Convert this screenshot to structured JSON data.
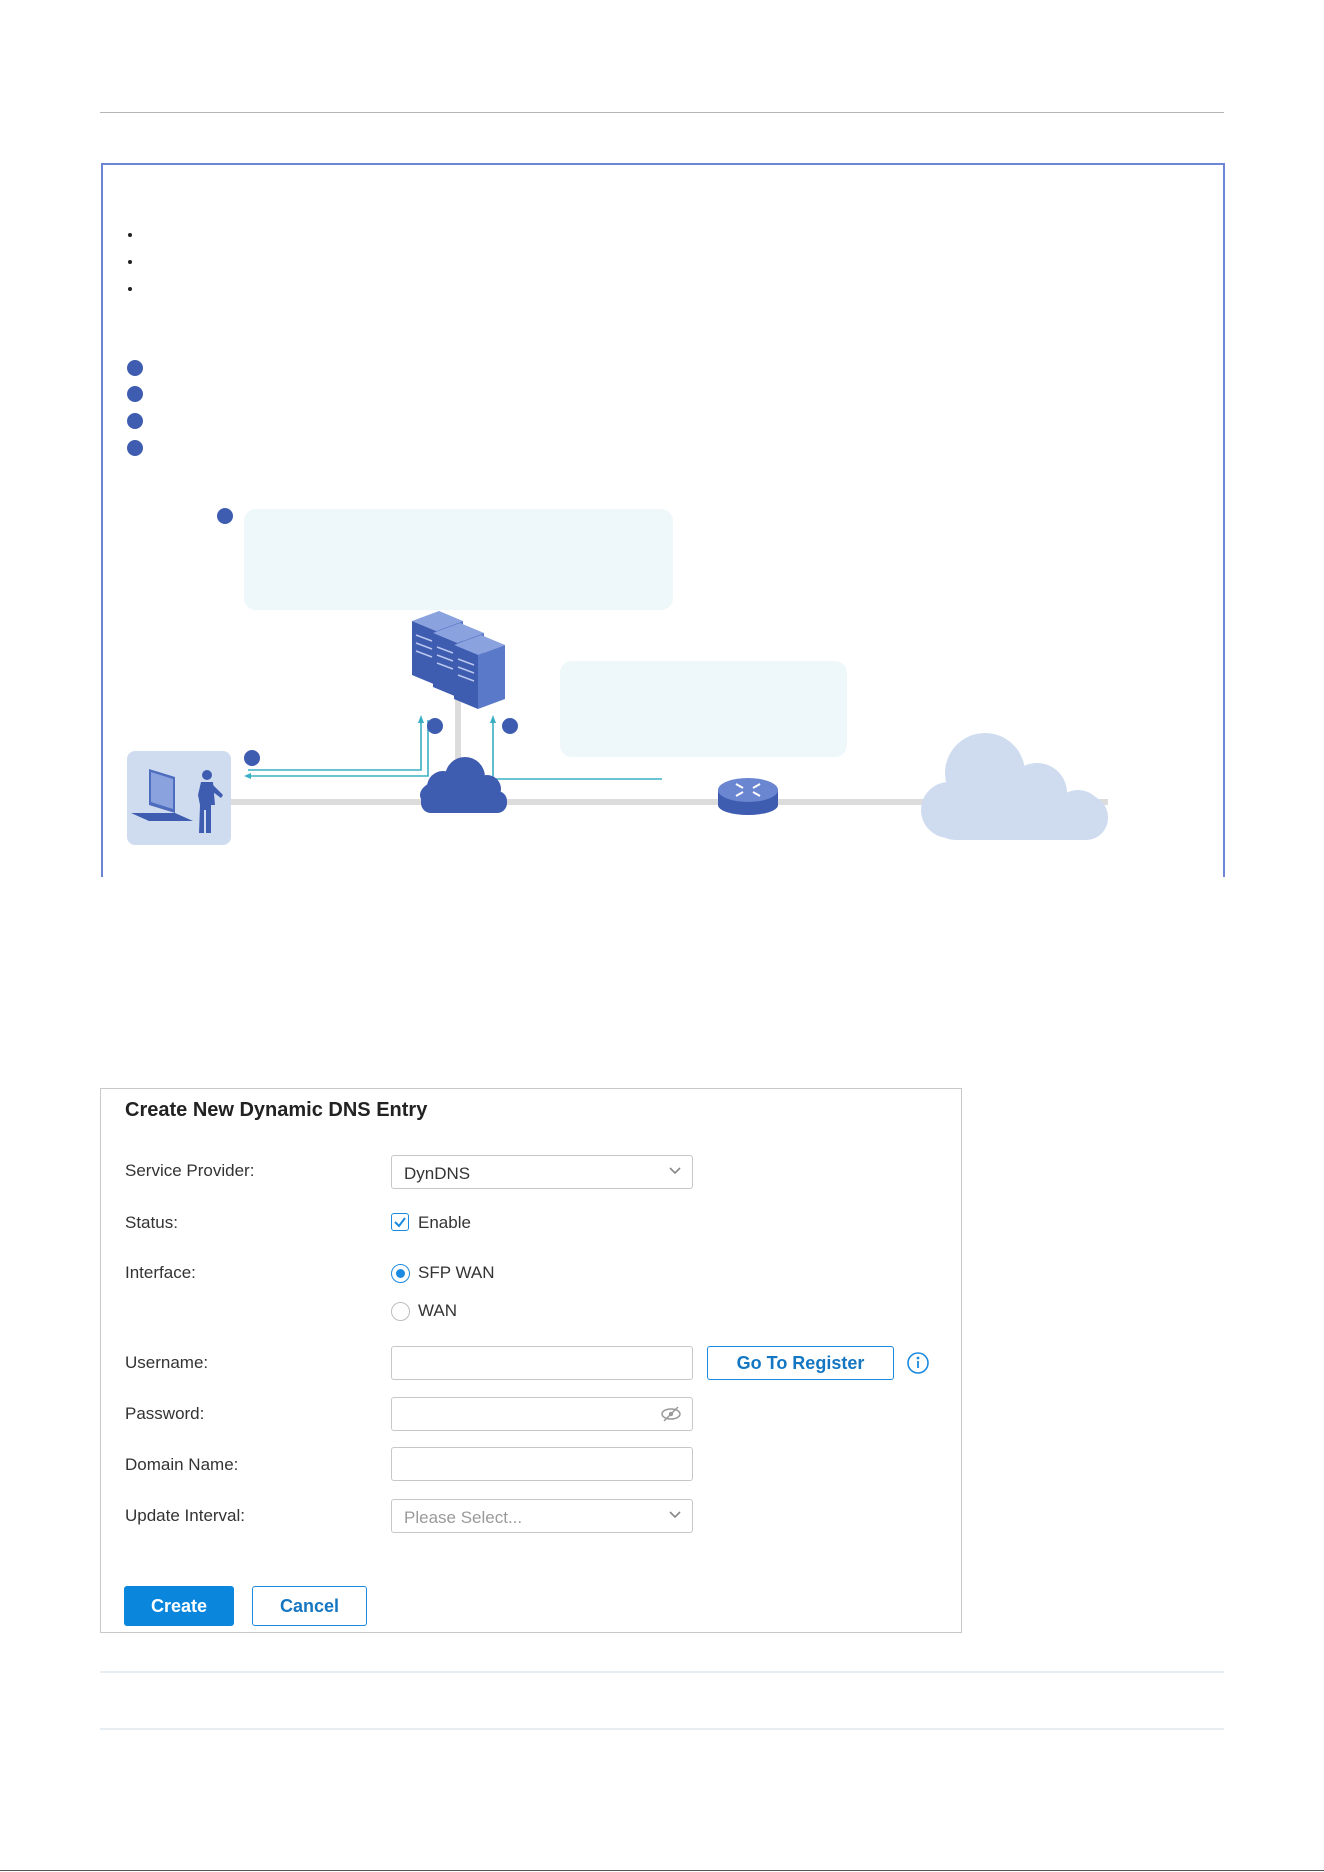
{
  "form": {
    "title": "Create New Dynamic DNS Entry",
    "service_provider": {
      "label": "Service Provider:",
      "value": "DynDNS"
    },
    "status": {
      "label": "Status:",
      "option_label": "Enable",
      "checked": true
    },
    "interface": {
      "label": "Interface:",
      "options": [
        {
          "label": "SFP WAN",
          "selected": true
        },
        {
          "label": "WAN",
          "selected": false
        }
      ]
    },
    "username": {
      "label": "Username:",
      "value": ""
    },
    "go_to_register_label": "Go To Register",
    "password": {
      "label": "Password:",
      "value": ""
    },
    "domain_name": {
      "label": "Domain Name:",
      "value": ""
    },
    "update_interval": {
      "label": "Update Interval:",
      "placeholder": "Please Select..."
    },
    "create_label": "Create",
    "cancel_label": "Cancel"
  },
  "colors": {
    "accent": "#0a86dd",
    "diagram_border": "#6c85d6",
    "step_dot": "#3e5cb0",
    "device_blue": "#4f6dbf",
    "arrow_teal": "#3ab0c4",
    "callout_bg": "#eef7f9",
    "cloud_light": "#cfdcf0"
  },
  "icons": [
    "chevron-down-icon",
    "checkmark-icon",
    "eye-off-icon",
    "info-icon",
    "laptop-icon",
    "person-icon",
    "server-icon",
    "cloud-icon",
    "router-icon"
  ]
}
